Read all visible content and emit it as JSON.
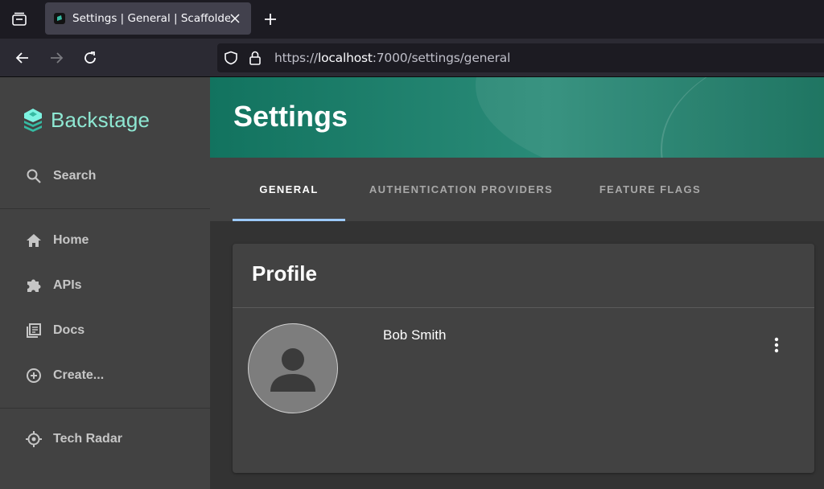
{
  "browser": {
    "tab_title": "Settings | General | Scaffolded",
    "url_scheme": "https://",
    "url_host": "localhost",
    "url_rest": ":7000/settings/general"
  },
  "sidebar": {
    "logo_text": "Backstage",
    "search_label": "Search",
    "items": [
      {
        "label": "Home",
        "icon": "home-icon"
      },
      {
        "label": "APIs",
        "icon": "puzzle-icon"
      },
      {
        "label": "Docs",
        "icon": "library-books-icon"
      },
      {
        "label": "Create...",
        "icon": "add-circle-outline-icon"
      }
    ],
    "bottom_items": [
      {
        "label": "Tech Radar",
        "icon": "radar-icon"
      }
    ]
  },
  "header": {
    "title": "Settings"
  },
  "tabs": [
    {
      "label": "GENERAL",
      "active": true
    },
    {
      "label": "AUTHENTICATION PROVIDERS",
      "active": false
    },
    {
      "label": "FEATURE FLAGS",
      "active": false
    }
  ],
  "profile": {
    "title": "Profile",
    "user_name": "Bob Smith"
  },
  "colors": {
    "accent": "#9cc9ff",
    "logo": "#8ee7d2",
    "header_bg": "#1b7d68"
  }
}
